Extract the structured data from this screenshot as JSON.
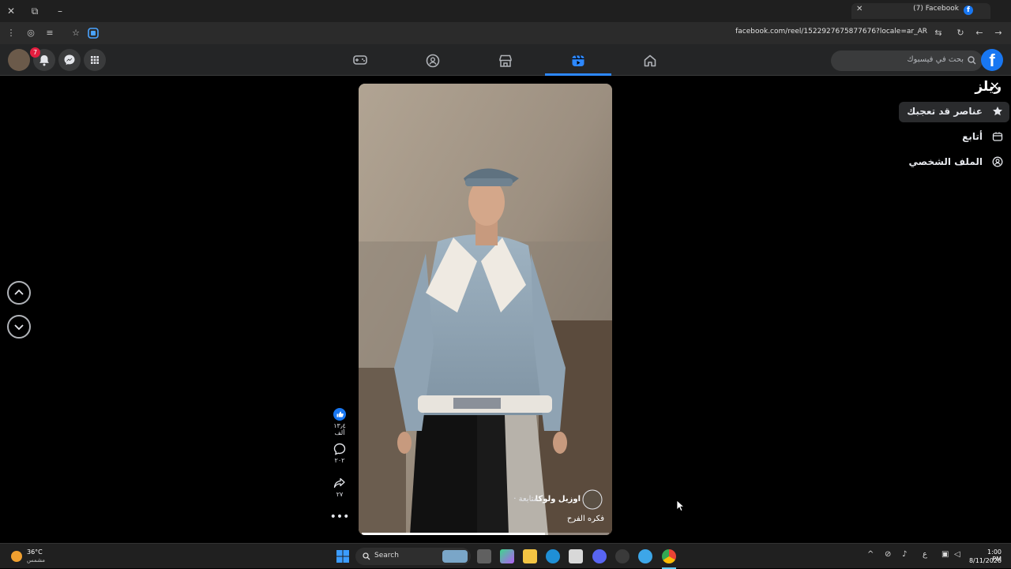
{
  "browser": {
    "tab_title": "(7) Facebook",
    "tab_favicon_letter": "f",
    "url": "facebook.com/reel/1522927675877676?locale=ar_AR",
    "icons": [
      "close-window-icon",
      "restore-icon",
      "minimize-icon",
      "new-tab-icon",
      "menu-icon",
      "extensions-icon",
      "bookmark-icon",
      "profile-icon",
      "reload-icon",
      "back-icon",
      "forward-icon"
    ]
  },
  "header": {
    "notification_count": "7",
    "search_placeholder": "بحث في فيسبوك",
    "logo": "f",
    "nav_tabs": [
      "gaming",
      "groups",
      "marketplace",
      "reels",
      "home"
    ],
    "active_tab": "reels"
  },
  "reels_panel": {
    "title": "ريلز",
    "items": [
      {
        "label": "عناصر قد تعجبك",
        "icon": "star-icon"
      },
      {
        "label": "أتابع",
        "icon": "following-icon"
      },
      {
        "label": "الملف الشخصي",
        "icon": "profile-icon"
      }
    ]
  },
  "video": {
    "author": "اوزيل ولوكا",
    "follow_label": "· متابعة",
    "caption": "فكره الفرح",
    "progress": 0.74
  },
  "actions": {
    "likes": "١٣٫٤ ألف",
    "comments": "٢٠٢",
    "shares": "٢٧"
  },
  "taskbar": {
    "weather_temp": "36°C",
    "weather_desc": "مشمس",
    "search_label": "Search",
    "time": "1:00 PM",
    "date": "8/11/2026"
  },
  "colors": {
    "accent": "#2d88ff",
    "brand": "#1877f2",
    "badge": "#e41e3f"
  }
}
